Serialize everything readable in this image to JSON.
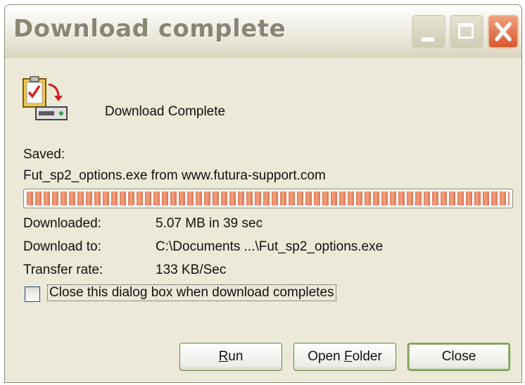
{
  "window": {
    "title": "Download complete",
    "controls": {
      "minimize_icon": "minimize-icon",
      "maximize_icon": "maximize-icon",
      "close_icon": "close-icon"
    }
  },
  "content": {
    "heading": "Download Complete",
    "saved_label": "Saved:",
    "filename_line": "Fut_sp2_options.exe from www.futura-support.com",
    "progress_percent": 100,
    "details": [
      {
        "label": "Downloaded:",
        "value": "5.07 MB in 39 sec"
      },
      {
        "label": "Download to:",
        "value": "C:\\Documents ...\\Fut_sp2_options.exe"
      },
      {
        "label": "Transfer rate:",
        "value": "133 KB/Sec"
      }
    ],
    "close_when_complete": {
      "label": "Close this dialog box when download completes",
      "checked": false
    }
  },
  "buttons": {
    "run": {
      "prefix": "",
      "accel": "R",
      "suffix": "un"
    },
    "open_folder": {
      "prefix": "Open ",
      "accel": "F",
      "suffix": "older"
    },
    "close": {
      "label": "Close"
    }
  },
  "colors": {
    "face": "#ECE9D8",
    "progress": "#E07A5A",
    "close_button": "#D9572C"
  }
}
